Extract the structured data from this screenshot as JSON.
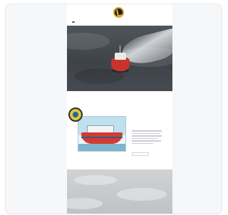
{
  "site": {
    "logo_icon": "anchor-emblem-icon",
    "menu_icon": "menu-icon"
  },
  "hero": {
    "image_icon": "boat-wake-photo"
  },
  "feature": {
    "title": "",
    "button_label": "",
    "art_icon": "boat-illustration-icon"
  },
  "bottom": {
    "image_icon": "sea-surface-photo"
  },
  "colors": {
    "card_bg": "#f6f7f9",
    "hull_red": "#c8342c",
    "logo_gold": "#d9a520"
  }
}
